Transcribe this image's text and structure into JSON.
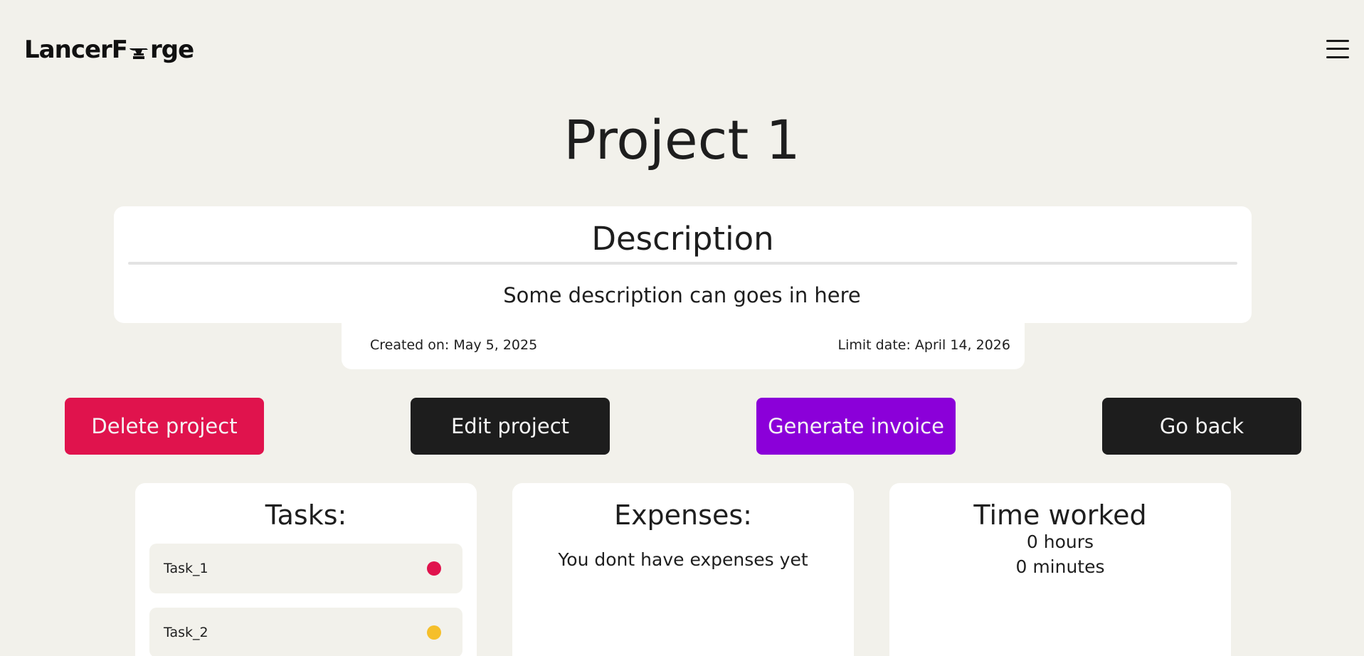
{
  "header": {
    "logo_left": "LancerF",
    "logo_right": "rge",
    "menu_icon": "hamburger-menu-icon"
  },
  "project": {
    "title": "Project 1",
    "description_heading": "Description",
    "description_text": "Some description can goes in here",
    "created_on": "Created on: May 5, 2025",
    "limit_date": "Limit date: April 14, 2026"
  },
  "actions": {
    "delete_label": "Delete project",
    "edit_label": "Edit project",
    "invoice_label": "Generate invoice",
    "back_label": "Go back"
  },
  "tasks": {
    "title": "Tasks:",
    "items": [
      {
        "name": "Task_1",
        "status_color": "#e0134d"
      },
      {
        "name": "Task_2",
        "status_color": "#f5bf2a"
      }
    ]
  },
  "expenses": {
    "title": "Expenses:",
    "empty_text": "You dont have expenses yet"
  },
  "time_worked": {
    "title": "Time worked",
    "hours": "0 hours",
    "minutes": "0 minutes"
  },
  "colors": {
    "background": "#f2f1eb",
    "danger": "#e0134d",
    "dark": "#1d1d1d",
    "accent_purple": "#8b00d9",
    "warning": "#f5bf2a"
  }
}
